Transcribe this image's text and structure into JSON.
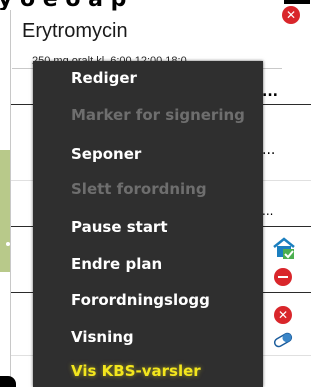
{
  "background": {
    "header_text": "y o e  o a  p",
    "medication": {
      "name": "Erytromycin",
      "dosage": "250 mg oralt kl. 6:00 12:00 18:0..."
    },
    "cells": [
      "...",
      "...",
      "...",
      "...",
      "..."
    ]
  },
  "context_menu": {
    "items": [
      {
        "label": "Rediger",
        "enabled": true
      },
      {
        "label": "Marker for signering",
        "enabled": false
      },
      {
        "label": "Seponer",
        "enabled": true
      },
      {
        "label": "Slett forordning",
        "enabled": false
      },
      {
        "label": "Pause start",
        "enabled": true
      },
      {
        "label": "Endre plan",
        "enabled": true
      },
      {
        "label": "Forordningslogg",
        "enabled": true
      },
      {
        "label": "Visning",
        "enabled": true
      },
      {
        "label": "Vis KBS-varsler",
        "enabled": true,
        "highlighted": true
      }
    ]
  },
  "colors": {
    "menu_bg": "#2f2f2f",
    "menu_text": "#ffffff",
    "menu_disabled": "#6e6e6e",
    "highlight": "#f3e61d",
    "status_red": "#d9262b",
    "green_tab": "#b8c98a"
  },
  "icons": {
    "status_top": "close-circle-icon",
    "status_mid": "close-circle-icon",
    "home": "house-check-icon",
    "stop": "stop-circle-icon",
    "pill": "pill-icon"
  }
}
